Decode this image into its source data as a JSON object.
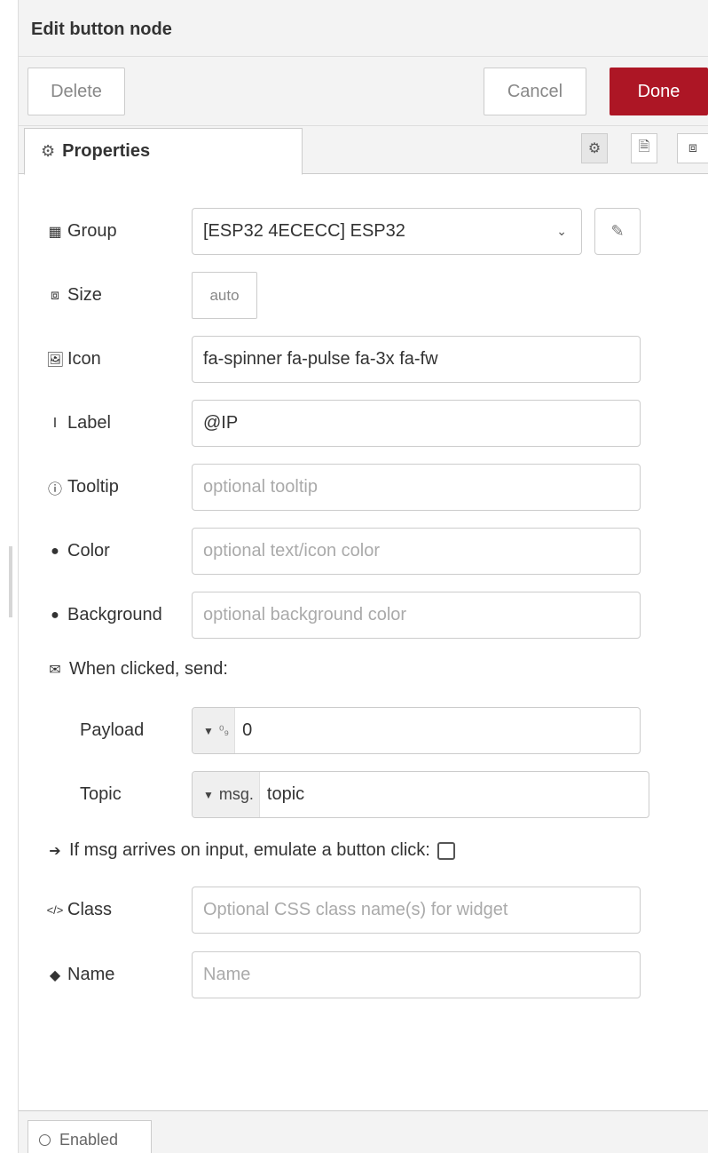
{
  "tray": {
    "title": "Edit button node",
    "delete_label": "Delete",
    "cancel_label": "Cancel",
    "done_label": "Done",
    "done_color": "#ad1625"
  },
  "tabs": {
    "properties_label": "Properties",
    "properties_icon": "cog-icon",
    "mini_tabs": [
      "settings-icon",
      "description-icon",
      "appearance-icon"
    ]
  },
  "form": {
    "group": {
      "label": "Group",
      "icon": "table-icon",
      "value": "[ESP32 4ECECC] ESP32"
    },
    "size": {
      "label": "Size",
      "icon": "size-icon",
      "value": "auto"
    },
    "icon": {
      "label": "Icon",
      "icon": "picture-icon",
      "value": "fa-spinner fa-pulse fa-3x fa-fw"
    },
    "label": {
      "label": "Label",
      "icon": "text-cursor-icon",
      "value": "@IP"
    },
    "tooltip": {
      "label": "Tooltip",
      "icon": "info-circle-icon",
      "placeholder": "optional tooltip"
    },
    "color": {
      "label": "Color",
      "icon": "tint-icon",
      "placeholder": "optional text/icon color"
    },
    "background": {
      "label": "Background",
      "icon": "tint-icon",
      "placeholder": "optional background color"
    },
    "when_clicked": {
      "label": "When clicked, send:",
      "icon": "envelope-icon"
    },
    "payload": {
      "label": "Payload",
      "type": "⁰₉",
      "value": "0"
    },
    "topic": {
      "label": "Topic",
      "type": "msg.",
      "value": "topic"
    },
    "emulate": {
      "label": "If msg arrives on input, emulate a button click:",
      "icon": "arrow-right-icon",
      "checked": false
    },
    "class": {
      "label": "Class",
      "icon": "code-icon",
      "placeholder": "Optional CSS class name(s) for widget"
    },
    "name": {
      "label": "Name",
      "icon": "tag-icon",
      "placeholder": "Name"
    }
  },
  "footer": {
    "enabled_label": "Enabled"
  }
}
